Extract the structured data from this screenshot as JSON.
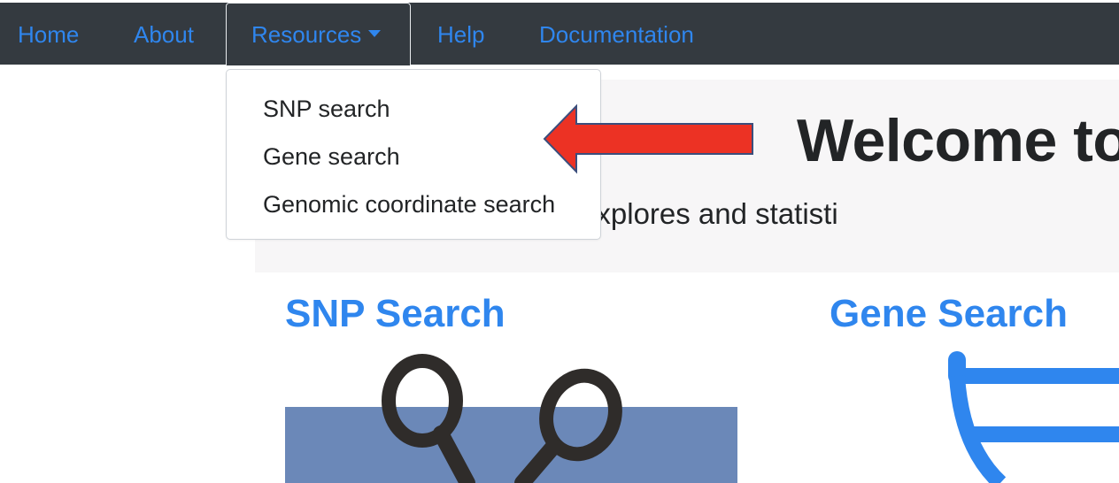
{
  "navbar": {
    "items": [
      {
        "label": "Home"
      },
      {
        "label": "About"
      },
      {
        "label": "Resources"
      },
      {
        "label": "Help"
      },
      {
        "label": "Documentation"
      }
    ]
  },
  "dropdown": {
    "items": [
      {
        "label": "SNP search"
      },
      {
        "label": "Gene search"
      },
      {
        "label": "Genomic coordinate search"
      }
    ]
  },
  "jumbotron": {
    "title": "Welcome to",
    "subtitle": "eb application that explores and statisti"
  },
  "sections": {
    "snp": {
      "title": "SNP Search"
    },
    "gene": {
      "title": "Gene Search"
    }
  },
  "colors": {
    "navbar_bg": "#343a40",
    "link": "#2f86ee",
    "arrow": "#ec3224",
    "snp_block": "#6b88b8"
  }
}
